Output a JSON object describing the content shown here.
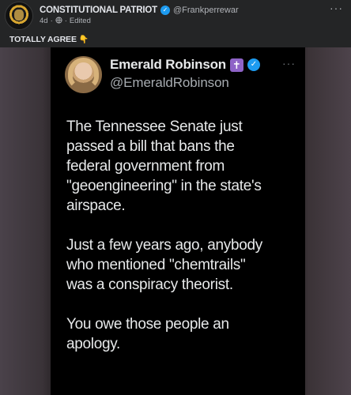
{
  "post": {
    "author_name": "CONSTITUTIONAL PATRIOT",
    "author_handle": "@Frankperrewar",
    "time_ago": "4d",
    "separator": "·",
    "edited_label": "Edited",
    "more_options": "···",
    "caption_text": "TOTALLY AGREE",
    "caption_emoji": "👇"
  },
  "tweet": {
    "name": "Emerald Robinson",
    "cross_badge": "✝",
    "verified_mark": "✓",
    "more_options": "···",
    "handle": "@EmeraldRobinson",
    "paragraphs": [
      "The Tennessee Senate just\npassed a bill that bans the\nfederal government from\n\"geoengineering\" in the state's\nairspace.",
      "Just a few years ago, anybody\nwho mentioned \"chemtrails\"\nwas a conspiracy theorist.",
      "You owe those people an\napology."
    ]
  },
  "icons": {
    "verified": "verified-icon",
    "globe": "globe-icon",
    "pointing_down": "pointing-down-icon",
    "cross": "cross-icon"
  },
  "colors": {
    "background": "#242526",
    "tweet_background": "#000000",
    "verified_blue": "#1d9bf0",
    "cross_purple": "#8e63c7",
    "text_primary": "#e4e6eb",
    "text_secondary": "#b0b3b8"
  }
}
